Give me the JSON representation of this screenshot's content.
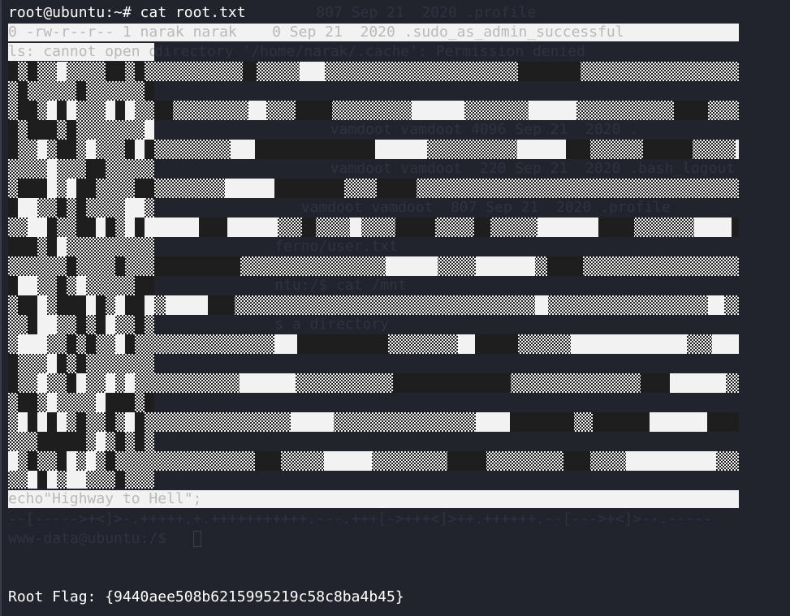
{
  "terminal": {
    "command_line": "root@ubuntu:~# cat root.txt",
    "bar_line_1": "0 -rw-r--r-- 1 narak narak    0 Sep 21  2020 .sudo_as_admin_successful",
    "bar_line_2": "ls: cannot open directory '/home/narak/.cache': Permission denied",
    "ghost_lines": [
      "                                   807 Sep 21  2020 .profile",
      "                    vamdoot vamdoot 4096 Sep 21  2020 .",
      "                    vamdoot vamdoot  220 Sep 21  2020 .bash_logout",
      "                    vamdoot vamdoot  807 Sep 21  2020 .profile",
      "                 ferno/user.txt",
      "                 ntu:/$ cat /mnt",
      "                 s a directory"
    ],
    "bar_line_3": "echo\"Highway to Hell\";",
    "brainfuck_line": "--[----->+<]>-.+++++.+.+++++++++++.---.+++[->+++<]>++.++++++.--[--->+<]>--.-----",
    "ghost_prompt": "www-data@ubuntu:/$ ",
    "flag_line": "Root Flag: {9440aee508b6215995219c58c8ba4b45}"
  },
  "colors": {
    "background": "#22242d",
    "text": "#ffffff",
    "art_light": "#f2f2f2",
    "art_dark": "#1e1e1e"
  }
}
